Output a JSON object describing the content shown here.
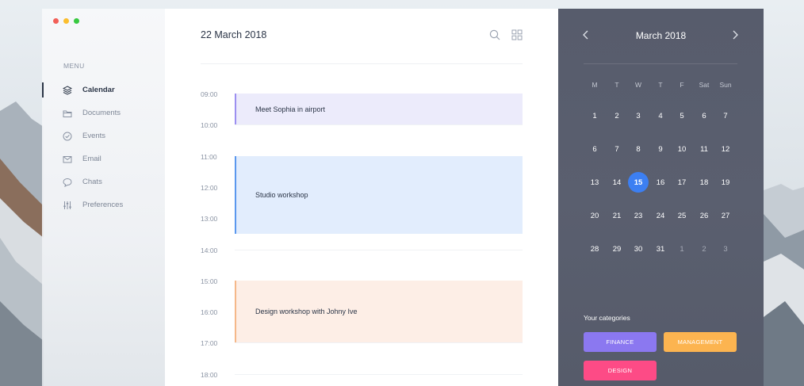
{
  "window": {
    "controls": [
      {
        "name": "close",
        "color": "#f25f58"
      },
      {
        "name": "minimize",
        "color": "#fbbe2e"
      },
      {
        "name": "maximize",
        "color": "#38c940"
      }
    ]
  },
  "sidebar": {
    "menu_label": "MENU",
    "items": [
      {
        "label": "Calendar",
        "icon": "layers-icon",
        "active": true
      },
      {
        "label": "Documents",
        "icon": "folder-icon",
        "active": false
      },
      {
        "label": "Events",
        "icon": "check-circle-icon",
        "active": false
      },
      {
        "label": "Email",
        "icon": "mail-icon",
        "active": false
      },
      {
        "label": "Chats",
        "icon": "chat-icon",
        "active": false
      },
      {
        "label": "Preferences",
        "icon": "sliders-icon",
        "active": false
      }
    ]
  },
  "main": {
    "date_title": "22 March 2018",
    "toolbar": {
      "search_icon": "search-icon",
      "grid_icon": "grid-icon"
    },
    "times": [
      "09:00",
      "10:00",
      "11:00",
      "12:00",
      "13:00",
      "14:00",
      "15:00",
      "16:00",
      "17:00",
      "18:00"
    ],
    "events": [
      {
        "title": "Meet Sophia in airport",
        "start": "09:00",
        "end": "10:00",
        "bg": "#ecebfb",
        "accent": "#9c8ff0"
      },
      {
        "title": "Studio workshop",
        "start": "11:00",
        "end": "13:30",
        "bg": "#e2edfd",
        "accent": "#5b98ee"
      },
      {
        "title": "Design workshop with Johny Ive",
        "start": "15:00",
        "end": "17:00",
        "bg": "#fdeee6",
        "accent": "#f5b889"
      }
    ]
  },
  "calendar": {
    "month_title": "March 2018",
    "weekdays": [
      "M",
      "T",
      "W",
      "T",
      "F",
      "Sat",
      "Sun"
    ],
    "weeks": [
      [
        {
          "d": "1"
        },
        {
          "d": "2"
        },
        {
          "d": "3"
        },
        {
          "d": "4"
        },
        {
          "d": "5"
        },
        {
          "d": "6"
        },
        {
          "d": "7"
        }
      ],
      [
        {
          "d": "6"
        },
        {
          "d": "7"
        },
        {
          "d": "8"
        },
        {
          "d": "9"
        },
        {
          "d": "10"
        },
        {
          "d": "11"
        },
        {
          "d": "12"
        }
      ],
      [
        {
          "d": "13"
        },
        {
          "d": "14"
        },
        {
          "d": "15",
          "selected": true
        },
        {
          "d": "16"
        },
        {
          "d": "17"
        },
        {
          "d": "18"
        },
        {
          "d": "19"
        }
      ],
      [
        {
          "d": "20"
        },
        {
          "d": "21"
        },
        {
          "d": "23"
        },
        {
          "d": "24"
        },
        {
          "d": "25"
        },
        {
          "d": "26"
        },
        {
          "d": "27"
        }
      ],
      [
        {
          "d": "28"
        },
        {
          "d": "29"
        },
        {
          "d": "30"
        },
        {
          "d": "31"
        },
        {
          "d": "1",
          "muted": true
        },
        {
          "d": "2",
          "muted": true
        },
        {
          "d": "3",
          "muted": true
        }
      ]
    ],
    "categories_label": "Your categories",
    "categories": [
      {
        "label": "FINANCE",
        "color": "#8b78f0"
      },
      {
        "label": "MANAGEMENT",
        "color": "#fcb450"
      },
      {
        "label": "DESIGN",
        "color": "#fd4b86"
      }
    ]
  }
}
